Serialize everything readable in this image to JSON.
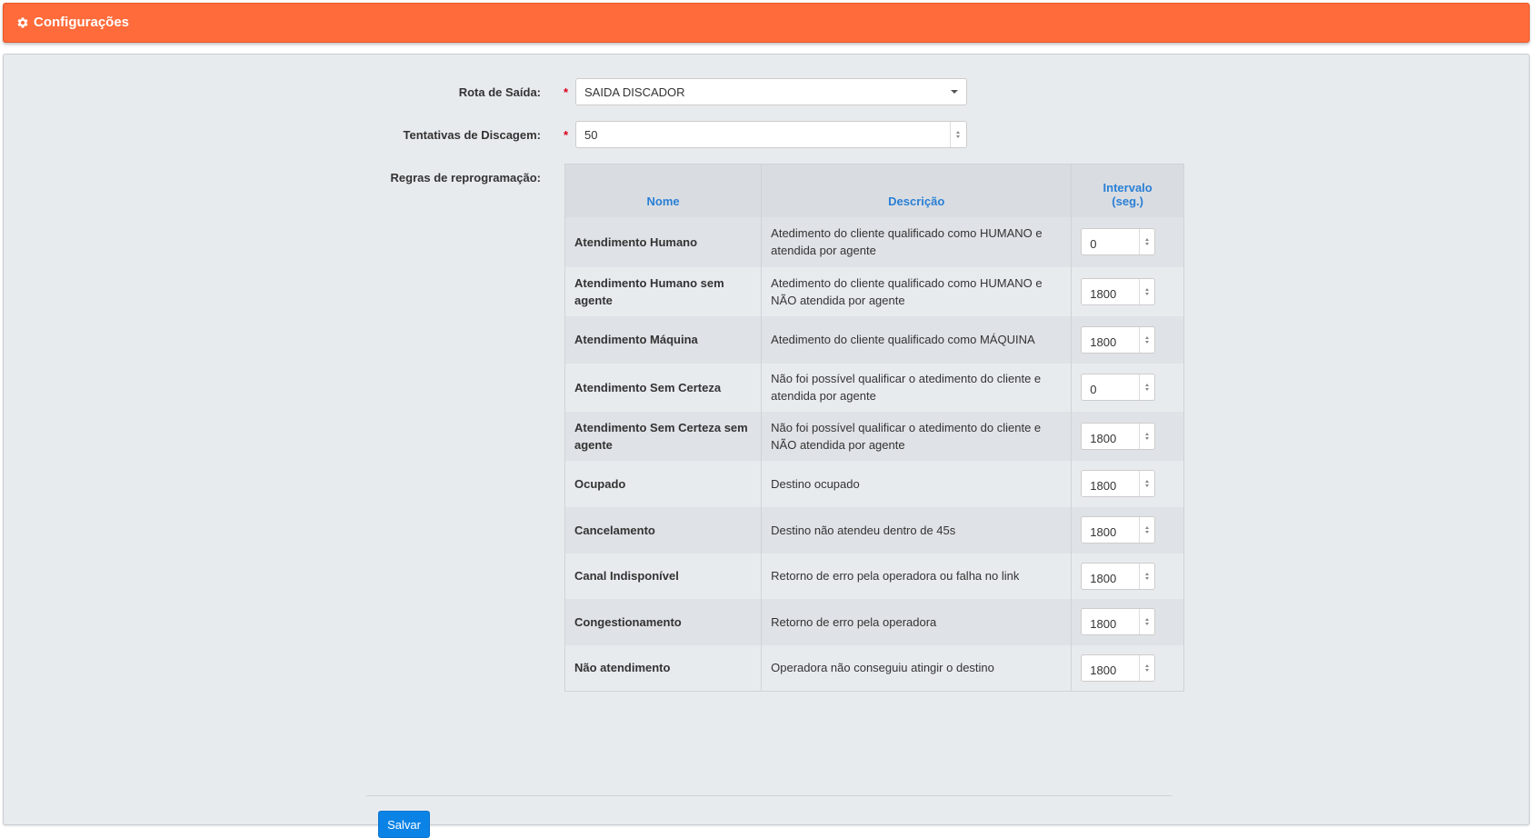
{
  "header": {
    "title": "Configurações",
    "icon": "gear-icon"
  },
  "form": {
    "route_label": "Rota de Saída:",
    "route_value": "SAIDA DISCADOR",
    "attempts_label": "Tentativas de Discagem:",
    "attempts_value": "50",
    "rules_label": "Regras de reprogramação:",
    "required_mark": "*"
  },
  "rules_table": {
    "headers": {
      "nome": "Nome",
      "descricao": "Descrição",
      "intervalo_line1": "Intervalo",
      "intervalo_line2": "(seg.)"
    },
    "rows": [
      {
        "nome": "Atendimento Humano",
        "descricao": "Atedimento do cliente qualificado como HUMANO e atendida por agente",
        "intervalo": "0"
      },
      {
        "nome": "Atendimento Humano sem agente",
        "descricao": "Atedimento do cliente qualificado como HUMANO e NÃO atendida por agente",
        "intervalo": "1800"
      },
      {
        "nome": "Atendimento Máquina",
        "descricao": "Atedimento do cliente qualificado como MÁQUINA",
        "intervalo": "1800"
      },
      {
        "nome": "Atendimento Sem Certeza",
        "descricao": "Não foi possível qualificar o atedimento do cliente e atendida por agente",
        "intervalo": "0"
      },
      {
        "nome": "Atendimento Sem Certeza sem agente",
        "descricao": "Não foi possível qualificar o atedimento do cliente e NÃO atendida por agente",
        "intervalo": "1800"
      },
      {
        "nome": "Ocupado",
        "descricao": "Destino ocupado",
        "intervalo": "1800"
      },
      {
        "nome": "Cancelamento",
        "descricao": "Destino não atendeu dentro de 45s",
        "intervalo": "1800"
      },
      {
        "nome": "Canal Indisponível",
        "descricao": "Retorno de erro pela operadora ou falha no link",
        "intervalo": "1800"
      },
      {
        "nome": "Congestionamento",
        "descricao": "Retorno de erro pela operadora",
        "intervalo": "1800"
      },
      {
        "nome": "Não atendimento",
        "descricao": "Operadora não conseguiu atingir o destino",
        "intervalo": "1800"
      }
    ]
  },
  "actions": {
    "save_label": "Salvar"
  },
  "colors": {
    "header_bg": "#ff6b3a",
    "panel_bg": "#e8ebee",
    "link_blue": "#2a7fd4",
    "save_btn": "#0b83e6",
    "required": "#d9001b"
  }
}
